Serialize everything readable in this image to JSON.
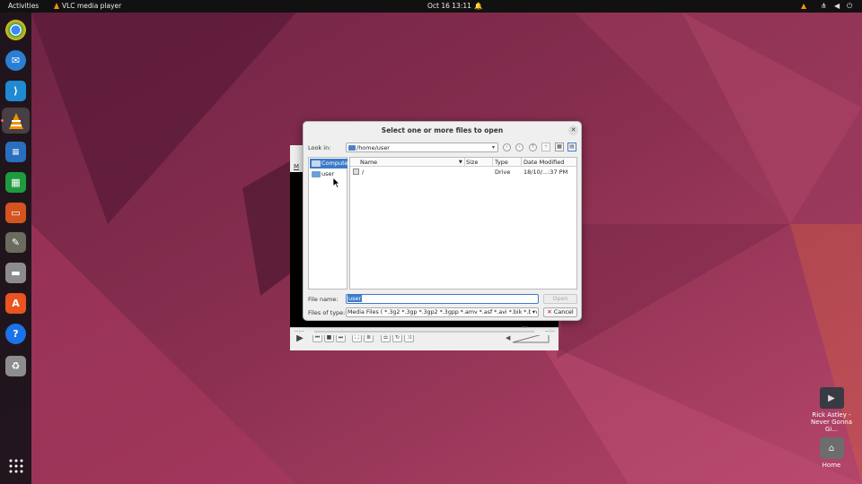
{
  "topbar": {
    "activities": "Activities",
    "app_name": "VLC media player",
    "clock": "Oct 16  13:11"
  },
  "dock": {
    "items": [
      {
        "name": "Google Chrome",
        "icon": "chrome-icon",
        "color": "#dd4b39"
      },
      {
        "name": "Thunderbird",
        "icon": "thunderbird-icon",
        "color": "#2a7fd4"
      },
      {
        "name": "Visual Studio Code",
        "icon": "vscode-icon",
        "color": "#1f8ad2"
      },
      {
        "name": "VLC media player",
        "icon": "vlc-icon",
        "color": "#f39200",
        "active": true
      },
      {
        "name": "LibreOffice Writer",
        "icon": "writer-icon",
        "color": "#2a6fbf"
      },
      {
        "name": "LibreOffice Calc",
        "icon": "calc-icon",
        "color": "#1e9b3f"
      },
      {
        "name": "LibreOffice Impress",
        "icon": "impress-icon",
        "color": "#d3541f"
      },
      {
        "name": "GIMP",
        "icon": "gimp-icon",
        "color": "#6b6b5e"
      },
      {
        "name": "Files",
        "icon": "files-icon",
        "color": "#8c8c8c"
      },
      {
        "name": "Ubuntu Software",
        "icon": "software-icon",
        "color": "#e95420"
      },
      {
        "name": "Help",
        "icon": "help-icon",
        "color": "#1a73e8"
      },
      {
        "name": "Trash",
        "icon": "trash-icon",
        "color": "#8d8d8d"
      },
      {
        "name": "Show Applications",
        "icon": "app-grid-icon",
        "color": "#00000000"
      }
    ]
  },
  "desktop": {
    "video_label_line1": "Rick Astley -",
    "video_label_line2": "Never Gonna Gi...",
    "home_label": "Home"
  },
  "vlc": {
    "menu_letter": "M",
    "time_left": "--:--",
    "time_right": "--:--",
    "volume": "0%"
  },
  "dialog": {
    "title": "Select one or more files to open",
    "look_in_label": "Look in:",
    "look_in_value": "/home/user",
    "sidebar": [
      {
        "label": "Computer",
        "selected": true
      },
      {
        "label": "user",
        "selected": false
      }
    ],
    "columns": [
      "Name",
      "Size",
      "Type",
      "Date Modified"
    ],
    "rows": [
      {
        "name": "/",
        "size": "",
        "type": "Drive",
        "date": "18/10/...:37 PM"
      }
    ],
    "file_name_label": "File name:",
    "file_name_value": "user",
    "open_label": "Open",
    "files_of_type_label": "Files of type:",
    "files_of_type_value": "Media Files ( *.3g2 *.3gp *.3gp2 *.3gpp *.amv *.asf *.avi *.bik *.bin",
    "cancel_label": "Cancel"
  }
}
